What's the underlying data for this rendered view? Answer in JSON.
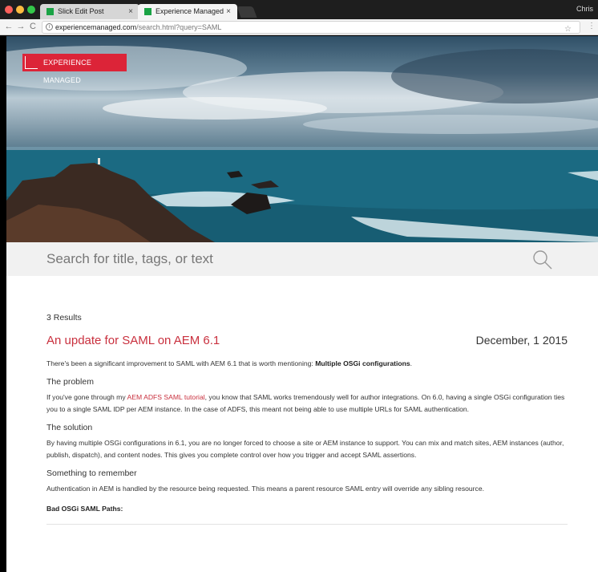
{
  "browser": {
    "tabs": [
      {
        "title": "Slick Edit Post",
        "close": "×"
      },
      {
        "title": "Experience Managed",
        "close": "×"
      }
    ],
    "profile": "Chris",
    "nav": {
      "back": "←",
      "forward": "→",
      "reload": "C"
    },
    "url": {
      "info": "i",
      "host": "experiencemanaged.com",
      "path": "/search.html?query=SAML"
    },
    "star": "☆",
    "menu": "⋮"
  },
  "site": {
    "brand": "EXPERIENCE MANAGED"
  },
  "search": {
    "placeholder": "Search for title, tags, or text"
  },
  "results": {
    "count": "3 Results",
    "post": {
      "title": "An update for SAML on AEM 6.1",
      "date": "December, 1 2015",
      "intro": "There's been a significant improvement to SAML with AEM 6.1 that is worth mentioning: ",
      "intro_bold": "Multiple OSGi configurations",
      "intro_end": ".",
      "sections": [
        {
          "heading": "The problem",
          "text_before": "If you've gone through my ",
          "link": "AEM ADFS SAML tutorial",
          "text_after": ", you know that SAML works tremendously well for author integrations. On 6.0, having a single OSGi configuration ties you to a single SAML IDP per AEM instance. In the case of ADFS, this meant not being able to use multiple URLs for SAML authentication."
        },
        {
          "heading": "The solution",
          "text": "By having multiple OSGi configurations in 6.1, you are no longer forced to choose a site or AEM instance to support. You can mix and match sites, AEM instances (author, publish, dispatch), and content nodes. This gives you complete control over how you trigger and accept SAML assertions."
        },
        {
          "heading": "Something to remember",
          "text": "Authentication in AEM is handled by the resource being requested. This means a parent resource SAML entry will override any sibling resource."
        }
      ],
      "bad_paths_label": "Bad OSGi SAML Paths:"
    }
  }
}
